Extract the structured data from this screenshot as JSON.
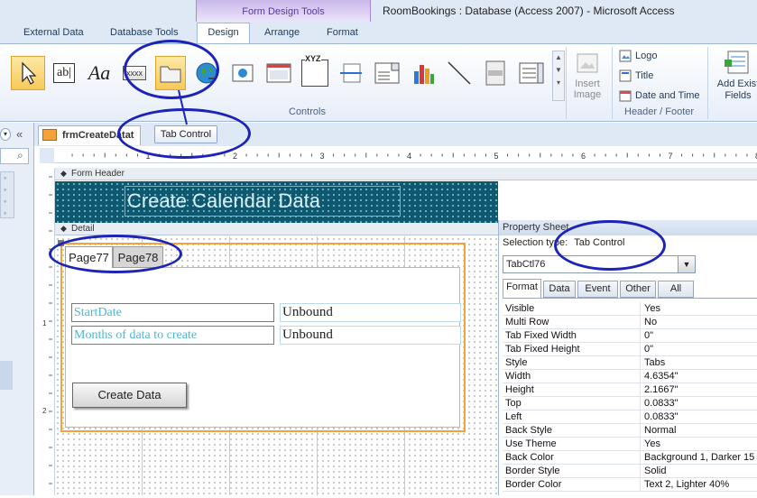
{
  "window": {
    "title": "RoomBookings : Database (Access 2007)  -  Microsoft Access",
    "contextual_tab_title": "Form Design Tools"
  },
  "ribbon": {
    "tabs": [
      {
        "label": "External Data"
      },
      {
        "label": "Database Tools"
      },
      {
        "label": "Design"
      },
      {
        "label": "Arrange"
      },
      {
        "label": "Format"
      }
    ],
    "active_tab": "Design",
    "controls_group_label": "Controls",
    "insert_image_label": "Insert Image",
    "header_footer": {
      "logo": "Logo",
      "title": "Title",
      "date_time": "Date and Time",
      "group_label": "Header / Footer"
    },
    "add_existing_fields": "Add Exist Fields",
    "aa_glyph": "Aa",
    "ab_glyph": "ab|",
    "xxxx_glyph": "xxxx",
    "xyz_glyph": "XYZ"
  },
  "tooltip": "Tab Control",
  "document_tab": "frmCreateDatat",
  "form": {
    "header_section": "Form Header",
    "detail_section": "Detail",
    "title": "Create Calendar Data",
    "pages": [
      "Page77",
      "Page78"
    ],
    "fields": [
      {
        "label": "StartDate",
        "value": "Unbound"
      },
      {
        "label": "Months of data to create",
        "value": "Unbound"
      }
    ],
    "button": "Create Data",
    "ruler_numbers": [
      "1",
      "2",
      "3",
      "4",
      "5",
      "6",
      "7",
      "8"
    ],
    "vruler_numbers": [
      "1",
      "2"
    ]
  },
  "property_sheet": {
    "header": "Property Sheet",
    "selection_type_label": "Selection type:",
    "selection_type_value": "Tab Control",
    "selected_object": "TabCtl76",
    "tabs": [
      "Format",
      "Data",
      "Event",
      "Other",
      "All"
    ],
    "active_tab": "Format",
    "rows": [
      {
        "name": "Visible",
        "value": "Yes"
      },
      {
        "name": "Multi Row",
        "value": "No"
      },
      {
        "name": "Tab Fixed Width",
        "value": "0\""
      },
      {
        "name": "Tab Fixed Height",
        "value": "0\""
      },
      {
        "name": "Style",
        "value": "Tabs"
      },
      {
        "name": "Width",
        "value": "4.6354\""
      },
      {
        "name": "Height",
        "value": "2.1667\""
      },
      {
        "name": "Top",
        "value": "0.0833\""
      },
      {
        "name": "Left",
        "value": "0.0833\""
      },
      {
        "name": "Back Style",
        "value": "Normal"
      },
      {
        "name": "Use Theme",
        "value": "Yes"
      },
      {
        "name": "Back Color",
        "value": "Background 1, Darker 15"
      },
      {
        "name": "Border Style",
        "value": "Solid"
      },
      {
        "name": "Border Color",
        "value": "Text 2, Lighter 40%"
      }
    ]
  },
  "colors": {
    "annotation_ellipse": "#1c23b8",
    "selection_border": "#f4a23c",
    "form_header_bg": "#0e5870",
    "label_text": "#4bb7d6"
  }
}
